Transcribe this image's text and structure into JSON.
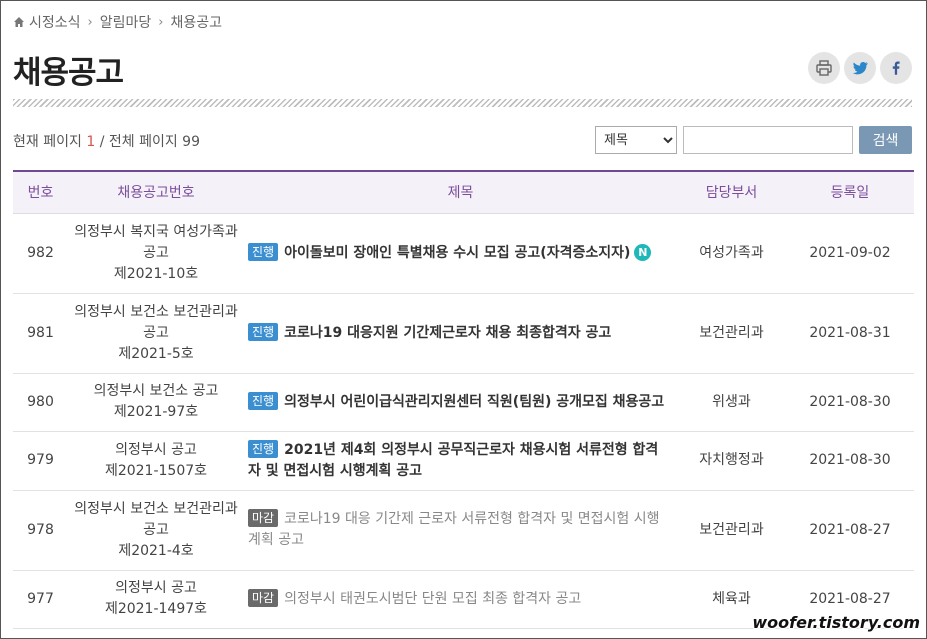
{
  "breadcrumb": {
    "items": [
      "시정소식",
      "알림마당",
      "채용공고"
    ]
  },
  "page": {
    "title": "채용공고"
  },
  "share": {
    "icons": [
      "print-icon",
      "twitter-icon",
      "facebook-icon"
    ]
  },
  "pageinfo": {
    "prefix": "현재 페이지",
    "current": "1",
    "middle": "/ 전체 페이지",
    "total": "99"
  },
  "search": {
    "select_value": "제목",
    "input_value": "",
    "button_label": "검색"
  },
  "table": {
    "headers": [
      "번호",
      "채용공고번호",
      "제목",
      "담당부서",
      "등록일"
    ],
    "rows": [
      {
        "no": "982",
        "notice_lines": [
          "의정부시 복지국 여성가족과",
          "공고",
          "제2021-10호"
        ],
        "status": "진행",
        "title": "아이돌보미 장애인 특별채용 수시 모집 공고(자격증소지자)",
        "new": "N",
        "dept": "여성가족과",
        "date": "2021-09-02"
      },
      {
        "no": "981",
        "notice_lines": [
          "의정부시 보건소 보건관리과",
          "공고",
          "제2021-5호"
        ],
        "status": "진행",
        "title": "코로나19 대응지원 기간제근로자 채용 최종합격자 공고",
        "dept": "보건관리과",
        "date": "2021-08-31"
      },
      {
        "no": "980",
        "notice_lines": [
          "의정부시 보건소 공고",
          "제2021-97호"
        ],
        "status": "진행",
        "title": "의정부시 어린이급식관리지원센터 직원(팀원) 공개모집 채용공고",
        "dept": "위생과",
        "date": "2021-08-30"
      },
      {
        "no": "979",
        "notice_lines": [
          "의정부시 공고",
          "제2021-1507호"
        ],
        "status": "진행",
        "title": "2021년 제4회 의정부시 공무직근로자 채용시험 서류전형 합격자 및 면접시험 시행계획 공고",
        "dept": "자치행정과",
        "date": "2021-08-30"
      },
      {
        "no": "978",
        "notice_lines": [
          "의정부시 보건소 보건관리과",
          "공고",
          "제2021-4호"
        ],
        "status": "마감",
        "title": "코로나19 대응 기간제 근로자 서류전형 합격자 및 면접시험 시행계획 공고",
        "dept": "보건관리과",
        "date": "2021-08-27"
      },
      {
        "no": "977",
        "notice_lines": [
          "의정부시 공고",
          "제2021-1497호"
        ],
        "status": "마감",
        "title": "의정부시 태권도시범단 단원 모집 최종 합격자 공고",
        "dept": "체육과",
        "date": "2021-08-27"
      }
    ]
  },
  "watermark": "woofer.tistory.com",
  "colors": {
    "accent": "#6e4b91",
    "badge_open": "#3b8fd0",
    "badge_closed": "#6a6a6a",
    "current_page": "#d9534f",
    "search_button": "#7a98b4"
  }
}
